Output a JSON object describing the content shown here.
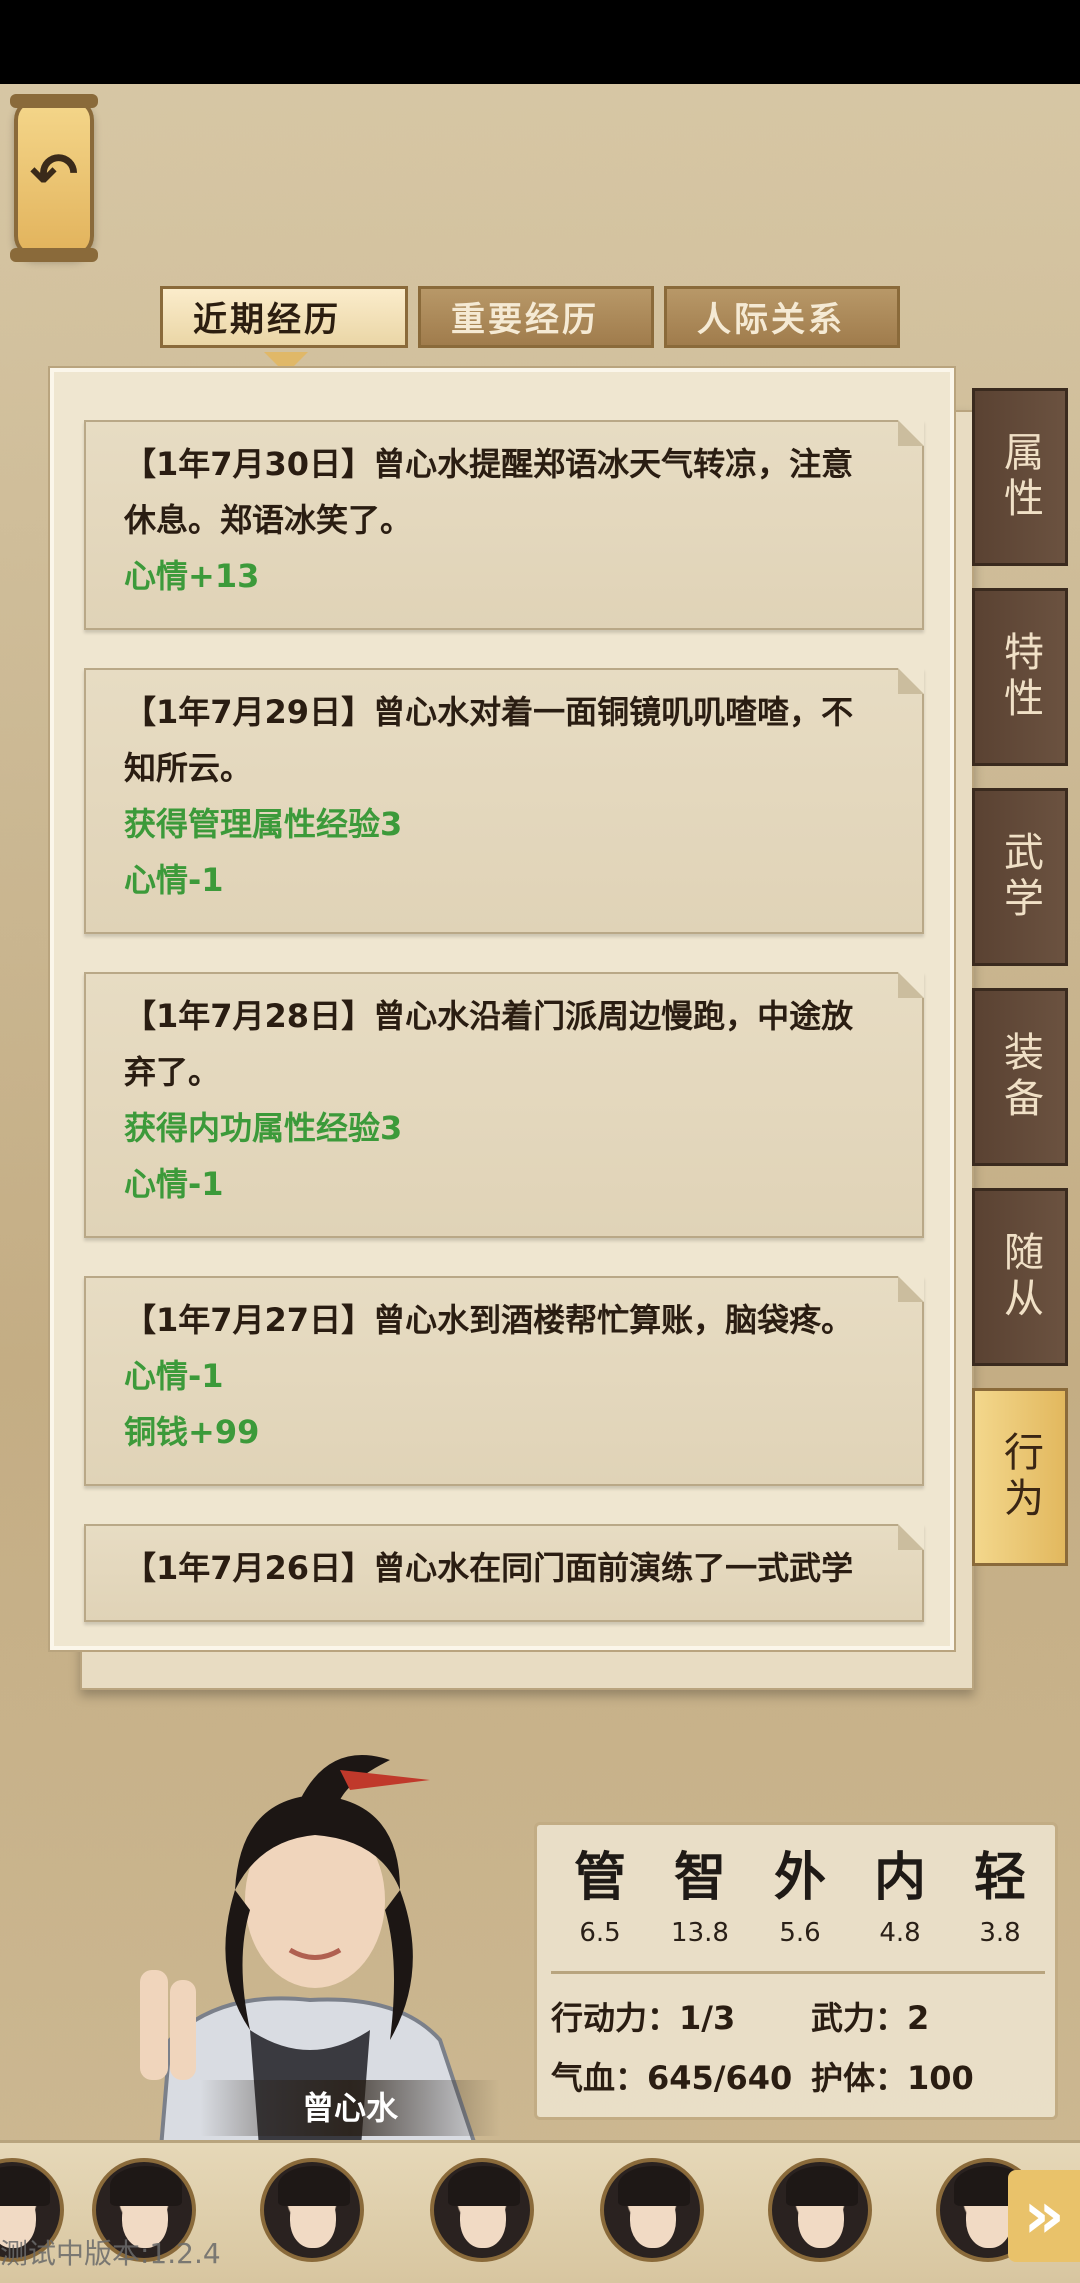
{
  "header": {
    "back_icon": "back-arrow-icon"
  },
  "tabs": [
    {
      "label": "近期经历",
      "active": true
    },
    {
      "label": "重要经历",
      "active": false
    },
    {
      "label": "人际关系",
      "active": false
    }
  ],
  "entries": [
    {
      "text": "【1年7月30日】曾心水提醒郑语冰天气转凉，注意休息。郑语冰笑了。",
      "effects": [
        "心情+13"
      ]
    },
    {
      "text": "【1年7月29日】曾心水对着一面铜镜叽叽喳喳，不知所云。",
      "effects": [
        "获得管理属性经验3",
        "心情-1"
      ]
    },
    {
      "text": "【1年7月28日】曾心水沿着门派周边慢跑，中途放弃了。",
      "effects": [
        "获得内功属性经验3",
        "心情-1"
      ]
    },
    {
      "text": "【1年7月27日】曾心水到酒楼帮忙算账，脑袋疼。",
      "effects": [
        "心情-1",
        "铜钱+99"
      ]
    },
    {
      "text": "【1年7月26日】曾心水在同门面前演练了一式武学",
      "effects": []
    }
  ],
  "side_tabs": [
    {
      "label": "属性",
      "active": false
    },
    {
      "label": "特性",
      "active": false
    },
    {
      "label": "武学",
      "active": false
    },
    {
      "label": "装备",
      "active": false
    },
    {
      "label": "随从",
      "active": false
    },
    {
      "label": "行为",
      "active": true
    }
  ],
  "character": {
    "name": "曾心水",
    "attributes": [
      {
        "glyph": "管",
        "value": "6.5"
      },
      {
        "glyph": "智",
        "value": "13.8"
      },
      {
        "glyph": "外",
        "value": "5.6"
      },
      {
        "glyph": "内",
        "value": "4.8"
      },
      {
        "glyph": "轻",
        "value": "3.8"
      }
    ],
    "action_points": "行动力：1/3",
    "force": "武力：2",
    "hp": "气血：645/640",
    "armor": "护体：100"
  },
  "bottom": {
    "version": "测试中版本:1.2.4",
    "next_icon": "double-chevron-right-icon"
  }
}
